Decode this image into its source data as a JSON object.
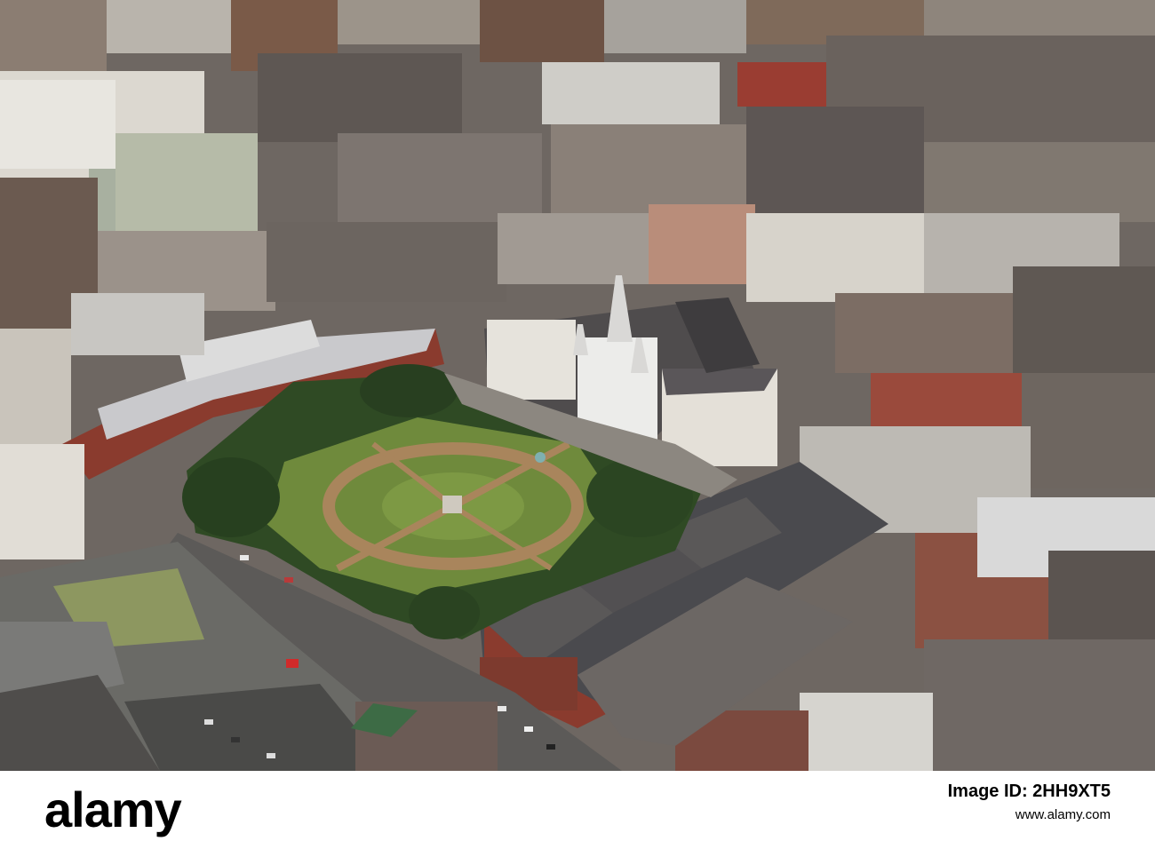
{
  "watermark": {
    "brand": "alamy",
    "image_id_line": "Image ID: 2HH9XT5",
    "site": "www.alamy.com"
  },
  "scene": {
    "description_tag": "aerial-city-square",
    "colors": {
      "roof_dark": "#4a4a4e",
      "roof_light": "#c9c9cc",
      "roof_red": "#8a3b2e",
      "tree": "#2f4a24",
      "lawn": "#6f8a3c",
      "path": "#a9855c",
      "cathedral": "#e8e8e6",
      "street": "#5c5a58"
    }
  }
}
